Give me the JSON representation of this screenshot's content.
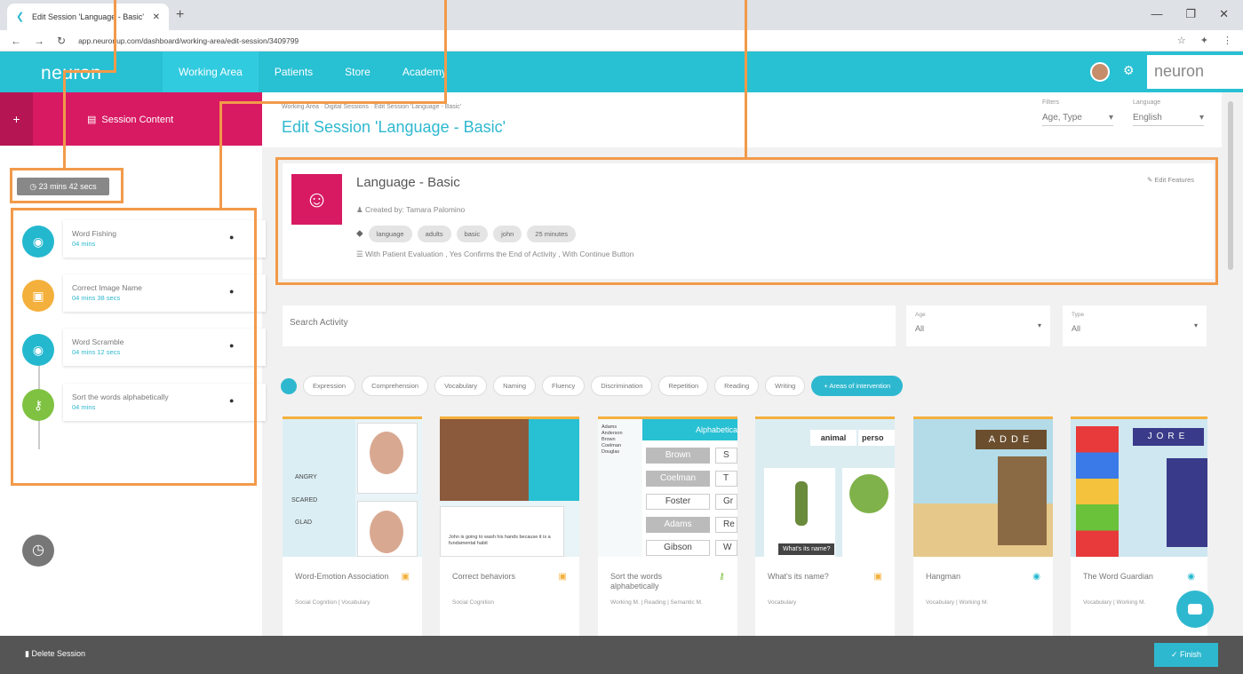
{
  "browser": {
    "tab_title": "Edit Session 'Language - Basic'",
    "url": "app.neuronup.com/dashboard/working-area/edit-session/3409799",
    "window_controls": [
      "—",
      "❐",
      "✕"
    ]
  },
  "appbar": {
    "logo": "neuron",
    "menu": [
      "Working Area",
      "Patients",
      "Store",
      "Academy"
    ],
    "active_menu": "Working Area"
  },
  "sidebar": {
    "header": "Session Content",
    "timer": "23 mins 42 secs",
    "activities": [
      {
        "name": "Word Fishing",
        "time": "04 mins",
        "color": "#24b8cf",
        "icon": "eye-icon"
      },
      {
        "name": "Correct Image Name",
        "time": "04 mins 38 secs",
        "color": "#f4b03c",
        "icon": "calendar-icon"
      },
      {
        "name": "Word Scramble",
        "time": "04 mins 12 secs",
        "color": "#24b8cf",
        "icon": "eye-icon"
      },
      {
        "name": "Sort the words alphabetically",
        "time": "04 mins",
        "color": "#7fc242",
        "icon": "key-icon"
      }
    ]
  },
  "header": {
    "breadcrumb": "Working Area · Digital Sessions · Edit Session 'Language - Basic'",
    "title": "Edit Session 'Language - Basic'",
    "filter_label": "Filters",
    "filter_value": "Age, Type",
    "language_label": "Language",
    "language_value": "English"
  },
  "session": {
    "title": "Language - Basic",
    "created_by": "Created by: Tamara Palomino",
    "tags": [
      "language",
      "adults",
      "basic",
      "john",
      "25 minutes"
    ],
    "options": "With Patient Evaluation , Yes Confirms the End of Activity , With Continue Button",
    "edit_label": "Edit Features"
  },
  "search": {
    "placeholder": "Search Activity",
    "age_label": "Age",
    "age_value": "All",
    "type_label": "Type",
    "type_value": "All"
  },
  "chips": [
    "Expression",
    "Comprehension",
    "Vocabulary",
    "Naming",
    "Fluency",
    "Discrimination",
    "Repetition",
    "Reading",
    "Writing"
  ],
  "chip_add": "+ Areas of intervention",
  "cards": [
    {
      "name": "Word-Emotion Association",
      "category": "Social Cognition | Vocabulary",
      "icon": "calendar-icon",
      "icon_color": "#f4b03c"
    },
    {
      "name": "Correct behaviors",
      "category": "Social Cognition",
      "icon": "calendar-icon",
      "icon_color": "#f4b03c"
    },
    {
      "name": "Sort the words alphabetically",
      "category": "Working M. | Reading | Semantic M.",
      "icon": "key-icon",
      "icon_color": "#7fc242"
    },
    {
      "name": "What's its name?",
      "category": "Vocabulary",
      "icon": "calendar-icon",
      "icon_color": "#f4b03c"
    },
    {
      "name": "Hangman",
      "category": "Vocabulary | Working M.",
      "icon": "eye-icon",
      "icon_color": "#24b8cf"
    },
    {
      "name": "The Word Guardian",
      "category": "Vocabulary | Working M.",
      "icon": "eye-icon",
      "icon_color": "#24b8cf"
    }
  ],
  "card_texts": {
    "emotions": [
      "ANGRY",
      "SCARED",
      "GLAD"
    ],
    "behavior_caption": "John is going to wash his hands because it is a fundamental habit",
    "alpha_header": "Alphabetical",
    "alpha_words": [
      "Adams",
      "Anderson",
      "Brown",
      "Coelman",
      "Douglas"
    ],
    "alpha_buttons": [
      "Brown",
      "Coelman",
      "Foster",
      "Adams",
      "Gibson"
    ],
    "alpha_right": [
      "S",
      "T",
      "Gr",
      "Re",
      "W"
    ],
    "name_words": [
      "animal",
      "perso"
    ],
    "name_tooltip": "What's its name?",
    "hangman_letters": "ADDE",
    "guardian_letters": "JORE"
  },
  "bottombar": {
    "delete": "Delete Session",
    "finish": "Finish"
  }
}
